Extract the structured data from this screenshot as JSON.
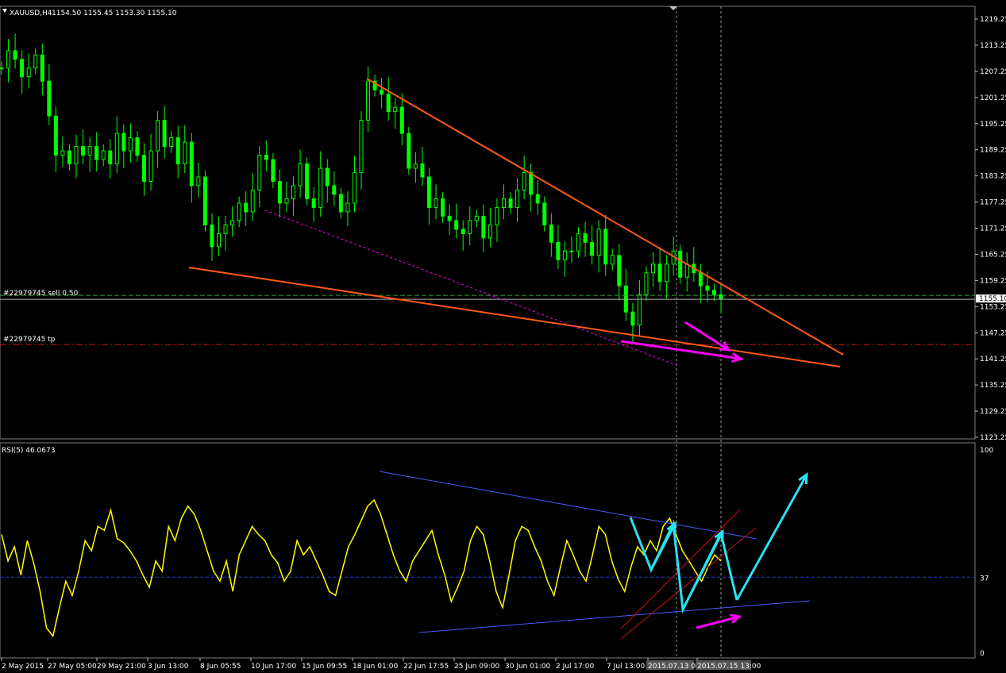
{
  "header": {
    "symbol": "XAUUSD,H4",
    "ohlc": "1154.50 1155.45 1153.30 1155.10"
  },
  "orders": {
    "sell_label": "#22979745 sell 0.50",
    "tp_label": "#22979745 tp",
    "sell_price": 1155.1,
    "tp_price": 1144.55
  },
  "colors": {
    "background": "#000000",
    "bull_candle": "#00ff00",
    "bear_candle": "#00ff00",
    "trendline": "#ff5a14",
    "magenta": "#ff00ff",
    "rsi_line": "#ffff00",
    "rsi_channel": "#4a5cff",
    "cyan_arrow": "#27e2f2",
    "red_channel": "#c41414",
    "grid": "#808080"
  },
  "chart_data": [
    {
      "type": "candlestick",
      "title": "XAUUSD,H4",
      "ylim": [
        1120.25,
        1222.25
      ],
      "y_ticks": [
        "1219.25",
        "1213.25",
        "1207.25",
        "1201.25",
        "1195.25",
        "1189.25",
        "1183.25",
        "1177.25",
        "1171.25",
        "1165.25",
        "1159.25",
        "1153.25",
        "1147.25",
        "1141.25",
        "1135.25",
        "1129.25",
        "1123.25"
      ],
      "current_price_label": "1155.10",
      "close_path": [
        1208,
        1212,
        1210,
        1206,
        1208,
        1211,
        1205,
        1197,
        1188,
        1189,
        1186,
        1190,
        1188,
        1190,
        1187,
        1189,
        1186,
        1193,
        1189,
        1192,
        1188,
        1182,
        1189,
        1196,
        1190,
        1192,
        1186,
        1191,
        1181,
        1183,
        1172,
        1167,
        1170,
        1172,
        1173,
        1177,
        1175,
        1180,
        1188,
        1187,
        1182,
        1177,
        1178,
        1181,
        1186,
        1178,
        1176,
        1185,
        1181,
        1179,
        1175,
        1177,
        1184,
        1196,
        1205,
        1203,
        1202,
        1198,
        1199,
        1193,
        1185,
        1186,
        1183,
        1176,
        1178,
        1174,
        1173,
        1171,
        1170,
        1173,
        1174,
        1169,
        1172,
        1176,
        1178,
        1176,
        1180,
        1184,
        1179,
        1177,
        1172,
        1168,
        1164,
        1166,
        1166,
        1170,
        1168,
        1165,
        1171,
        1163,
        1165,
        1158,
        1152,
        1149,
        1156,
        1161,
        1163,
        1159,
        1163,
        1166,
        1160,
        1163,
        1161,
        1158,
        1157,
        1156,
        1155
      ],
      "trendlines": [
        {
          "name": "upper-wedge",
          "from": [
            "18 Jun 01:00",
            1206
          ],
          "to": [
            "future",
            1141
          ]
        },
        {
          "name": "lower-wedge",
          "from": [
            "3 Jun 13:00",
            1163
          ],
          "to": [
            "future",
            1139
          ]
        },
        {
          "name": "support-dotted",
          "from": [
            "10 Jun 17:00",
            1175
          ],
          "to": [
            "2015.07.13",
            1139
          ]
        }
      ]
    },
    {
      "type": "line",
      "title": "RSI(5) 46.0673",
      "ylim": [
        0,
        100
      ],
      "y_ticks": [
        "100",
        "37",
        "0"
      ],
      "level": 37,
      "values": [
        58,
        45,
        52,
        38,
        55,
        44,
        30,
        12,
        8,
        22,
        35,
        28,
        40,
        55,
        50,
        62,
        60,
        70,
        56,
        54,
        50,
        45,
        38,
        32,
        45,
        40,
        62,
        55,
        66,
        72,
        68,
        60,
        50,
        40,
        35,
        45,
        30,
        48,
        55,
        62,
        58,
        55,
        48,
        44,
        35,
        40,
        55,
        48,
        52,
        45,
        38,
        30,
        28,
        40,
        52,
        58,
        65,
        72,
        75,
        68,
        58,
        48,
        40,
        35,
        45,
        50,
        55,
        60,
        48,
        38,
        25,
        32,
        40,
        55,
        62,
        58,
        45,
        30,
        22,
        38,
        55,
        62,
        60,
        52,
        45,
        35,
        28,
        42,
        55,
        48,
        40,
        35,
        48,
        62,
        58,
        45,
        36,
        30,
        42,
        52,
        48,
        55,
        50,
        62,
        66,
        58,
        50,
        45,
        40,
        35,
        42,
        48,
        45
      ],
      "x_tick_labels": [
        "2 May 2015",
        "27 May 05:00",
        "29 May 21:00",
        "3 Jun 13:00",
        "8 Jun 05:55",
        "10 Jun 17:00",
        "15 Jun 09:55",
        "18 Jun 01:00",
        "22 Jun 17:55",
        "25 Jun 09:00",
        "30 Jun 01:00",
        "2 Jul 17:00",
        "7 Jul 13:00",
        "2015.07.13 0",
        "2015.07.15 13:00"
      ]
    }
  ]
}
